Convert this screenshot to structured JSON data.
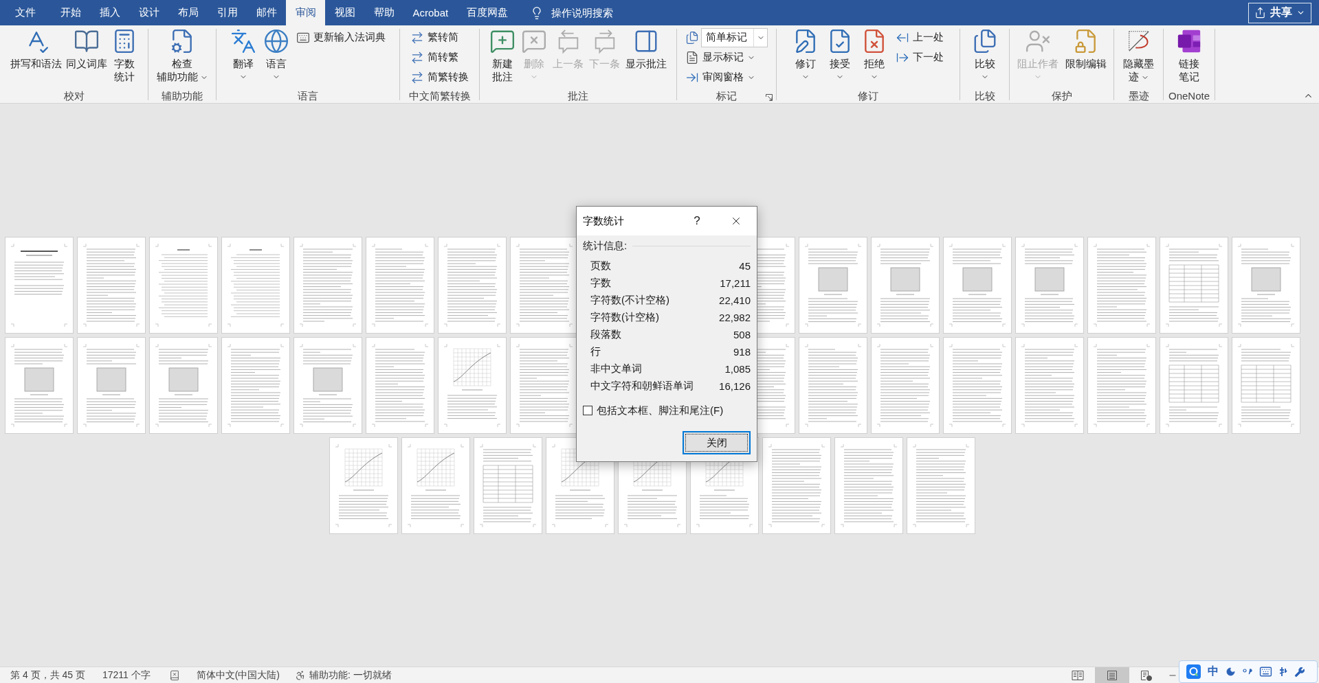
{
  "tabs": [
    {
      "label": "文件",
      "selected": false
    },
    {
      "label": "开始",
      "selected": false
    },
    {
      "label": "插入",
      "selected": false
    },
    {
      "label": "设计",
      "selected": false
    },
    {
      "label": "布局",
      "selected": false
    },
    {
      "label": "引用",
      "selected": false
    },
    {
      "label": "邮件",
      "selected": false
    },
    {
      "label": "审阅",
      "selected": true
    },
    {
      "label": "视图",
      "selected": false
    },
    {
      "label": "帮助",
      "selected": false
    },
    {
      "label": "Acrobat",
      "selected": false
    },
    {
      "label": "百度网盘",
      "selected": false
    }
  ],
  "search": {
    "placeholder": "操作说明搜索"
  },
  "share_button": {
    "label": "共享"
  },
  "ribbon": {
    "groups": [
      {
        "label": "校对",
        "launcher": false,
        "columns": [
          {
            "kind": "large",
            "label": "拼写和语法",
            "menu": false,
            "disabled": false
          },
          {
            "kind": "large",
            "label": "同义词库",
            "menu": false,
            "disabled": false
          },
          {
            "kind": "large",
            "label": "字数统计",
            "menu": false,
            "disabled": false
          }
        ]
      },
      {
        "label": "辅助功能",
        "launcher": false,
        "columns": [
          {
            "kind": "large",
            "label": "检查辅助功能",
            "menu": true,
            "disabled": false
          }
        ]
      },
      {
        "label": "语言",
        "launcher": false,
        "columns": [
          {
            "kind": "large",
            "label": "翻译",
            "menu": true,
            "disabled": false
          },
          {
            "kind": "large",
            "label": "语言",
            "menu": true,
            "disabled": false
          },
          {
            "kind": "stack",
            "items": [
              {
                "kind": "small",
                "label": "更新输入法词典",
                "menu": false,
                "disabled": false
              }
            ]
          }
        ]
      },
      {
        "label": "中文简繁转换",
        "launcher": false,
        "columns": [
          {
            "kind": "stack",
            "items": [
              {
                "kind": "small",
                "label": "繁转简",
                "menu": false,
                "disabled": false
              },
              {
                "kind": "small",
                "label": "简转繁",
                "menu": false,
                "disabled": false
              },
              {
                "kind": "small",
                "label": "简繁转换",
                "menu": false,
                "disabled": false
              }
            ]
          }
        ]
      },
      {
        "label": "批注",
        "launcher": false,
        "columns": [
          {
            "kind": "large",
            "label": "新建批注",
            "menu": false,
            "disabled": false
          },
          {
            "kind": "large",
            "label": "删除",
            "menu": true,
            "disabled": true
          },
          {
            "kind": "large",
            "label": "上一条",
            "menu": false,
            "disabled": true
          },
          {
            "kind": "large",
            "label": "下一条",
            "menu": false,
            "disabled": true
          },
          {
            "kind": "large",
            "label": "显示批注",
            "menu": false,
            "disabled": false
          }
        ]
      },
      {
        "label": "标记",
        "launcher": true,
        "columns": [
          {
            "kind": "stack",
            "items": [
              {
                "kind": "combo",
                "value": "简单标记"
              },
              {
                "kind": "small",
                "label": "显示标记",
                "menu": true,
                "disabled": false
              },
              {
                "kind": "small",
                "label": "审阅窗格",
                "menu": true,
                "disabled": false
              }
            ]
          }
        ]
      },
      {
        "label": "修订",
        "launcher": false,
        "columns": [
          {
            "kind": "large",
            "label": "修订",
            "menu": true,
            "disabled": false
          },
          {
            "kind": "large",
            "label": "接受",
            "menu": true,
            "disabled": false
          },
          {
            "kind": "large",
            "label": "拒绝",
            "menu": true,
            "disabled": false
          },
          {
            "kind": "stack",
            "items": [
              {
                "kind": "small",
                "label": "上一处",
                "menu": false,
                "disabled": false
              },
              {
                "kind": "small",
                "label": "下一处",
                "menu": false,
                "disabled": false
              }
            ]
          }
        ]
      },
      {
        "label": "比较",
        "launcher": false,
        "columns": [
          {
            "kind": "large",
            "label": "比较",
            "menu": true,
            "disabled": false
          }
        ]
      },
      {
        "label": "保护",
        "launcher": false,
        "columns": [
          {
            "kind": "large",
            "label": "阻止作者",
            "menu": true,
            "disabled": true
          },
          {
            "kind": "large",
            "label": "限制编辑",
            "menu": false,
            "disabled": false
          }
        ]
      },
      {
        "label": "墨迹",
        "launcher": false,
        "columns": [
          {
            "kind": "large",
            "label": "隐藏墨迹",
            "menu": true,
            "disabled": false
          }
        ]
      },
      {
        "label": "OneNote",
        "launcher": false,
        "columns": [
          {
            "kind": "large",
            "label": "链接笔记",
            "menu": false,
            "disabled": false
          }
        ]
      }
    ]
  },
  "page_rows": [
    [
      {
        "kind": "title"
      },
      {
        "kind": "text"
      },
      {
        "kind": "toc"
      },
      {
        "kind": "toc"
      },
      {
        "kind": "text"
      },
      {
        "kind": "text"
      },
      {
        "kind": "text"
      },
      {
        "kind": "text"
      },
      {
        "kind": "covered"
      },
      {
        "kind": "covered"
      },
      {
        "kind": "text"
      },
      {
        "kind": "figure"
      },
      {
        "kind": "figure"
      },
      {
        "kind": "figure"
      },
      {
        "kind": "figure"
      },
      {
        "kind": "text"
      },
      {
        "kind": "table"
      },
      {
        "kind": "figure"
      }
    ],
    [
      {
        "kind": "figure"
      },
      {
        "kind": "figure"
      },
      {
        "kind": "figure"
      },
      {
        "kind": "text"
      },
      {
        "kind": "figure"
      },
      {
        "kind": "text"
      },
      {
        "kind": "chart"
      },
      {
        "kind": "text"
      },
      {
        "kind": "covered"
      },
      {
        "kind": "covered"
      },
      {
        "kind": "text"
      },
      {
        "kind": "text"
      },
      {
        "kind": "text"
      },
      {
        "kind": "text"
      },
      {
        "kind": "text"
      },
      {
        "kind": "text"
      },
      {
        "kind": "table"
      },
      {
        "kind": "table"
      }
    ],
    [
      {
        "kind": "chart"
      },
      {
        "kind": "chart"
      },
      {
        "kind": "table"
      },
      {
        "kind": "chart"
      },
      {
        "kind": "chart"
      },
      {
        "kind": "chart"
      },
      {
        "kind": "text"
      },
      {
        "kind": "text"
      },
      {
        "kind": "text"
      }
    ]
  ],
  "dialog": {
    "title": "字数统计",
    "help": "?",
    "section": "统计信息:",
    "stats": [
      {
        "label": "页数",
        "value": "45"
      },
      {
        "label": "字数",
        "value": "17,211"
      },
      {
        "label": "字符数(不计空格)",
        "value": "22,410"
      },
      {
        "label": "字符数(计空格)",
        "value": "22,982"
      },
      {
        "label": "段落数",
        "value": "508"
      },
      {
        "label": "行",
        "value": "918"
      },
      {
        "label": "非中文单词",
        "value": "1,085"
      },
      {
        "label": "中文字符和朝鲜语单词",
        "value": "16,126"
      }
    ],
    "checkbox": {
      "label": "包括文本框、脚注和尾注(F)",
      "checked": false
    },
    "button": "关闭"
  },
  "status_bar": {
    "page": "第 4 页，共 45 页",
    "words": "17211 个字",
    "language": "简体中文(中国大陆)",
    "accessibility": "辅助功能: 一切就绪",
    "views": [
      {
        "selected": false
      },
      {
        "selected": true
      },
      {
        "selected": false
      }
    ]
  },
  "ime_toolbar": {
    "mode": "中"
  }
}
